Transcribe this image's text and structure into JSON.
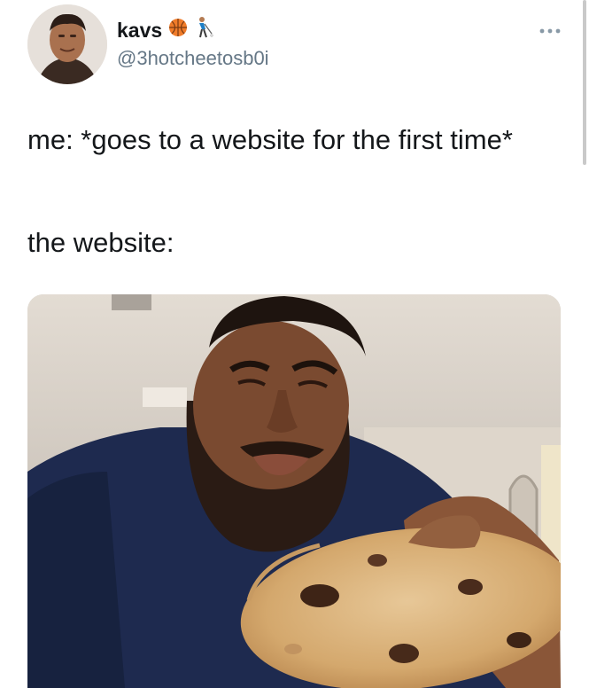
{
  "tweet": {
    "display_name": "kavs",
    "name_emojis": [
      "basketball-emoji",
      "golfer-emoji"
    ],
    "handle": "@3hotcheetosb0i",
    "text_line1": "me: *goes to a website for the first time*",
    "text_line2": "the website:",
    "media_description": "man with beard skeptically holding a chocolate chip cookie"
  },
  "colors": {
    "name": "#14171a",
    "handle": "#657786",
    "text": "#14171a",
    "shirt": "#1e2a4f"
  },
  "icons": {
    "more": "more-options-icon"
  }
}
